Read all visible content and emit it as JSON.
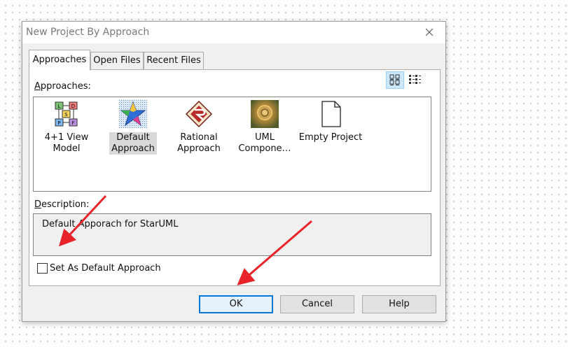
{
  "window": {
    "title": "New Project By Approach"
  },
  "tabs": [
    {
      "label": "Approaches",
      "active": true
    },
    {
      "label": "Open Files",
      "active": false
    },
    {
      "label": "Recent Files",
      "active": false
    }
  ],
  "approaches_label": {
    "mnemonic": "A",
    "rest": "pproaches:"
  },
  "view_buttons": [
    {
      "icon": "large-icons-view-icon",
      "active": true
    },
    {
      "icon": "list-view-icon",
      "active": false
    }
  ],
  "approaches": [
    {
      "line1": "4+1 View",
      "line2": "Model",
      "icon": "4plus1-model-icon",
      "selected": false
    },
    {
      "line1": "Default",
      "line2": "Approach",
      "icon": "default-approach-star-icon",
      "selected": true
    },
    {
      "line1": "Rational",
      "line2": "Approach",
      "icon": "rational-approach-icon",
      "selected": false
    },
    {
      "line1": "UML",
      "line2": "Compone…",
      "icon": "uml-component-icon",
      "selected": false
    },
    {
      "line1": "Empty Project",
      "line2": "",
      "icon": "empty-document-icon",
      "selected": false
    }
  ],
  "description_label": {
    "mnemonic": "D",
    "rest": "escription:"
  },
  "description_text": "Default Apporach for StarUML",
  "set_default": {
    "label": "Set As Default Approach",
    "checked": false
  },
  "buttons": {
    "ok": "OK",
    "cancel": "Cancel",
    "help": "Help"
  },
  "colors": {
    "accent": "#0078d7",
    "annotation_arrow": "#e8242a"
  }
}
